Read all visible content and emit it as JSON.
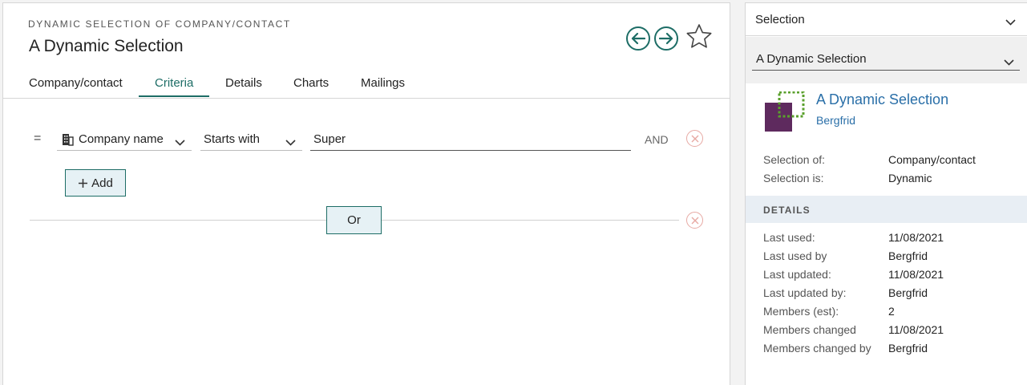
{
  "header": {
    "subtitle": "DYNAMIC SELECTION OF COMPANY/CONTACT",
    "title": "A Dynamic Selection"
  },
  "tabs": [
    {
      "label": "Company/contact",
      "active": false
    },
    {
      "label": "Criteria",
      "active": true
    },
    {
      "label": "Details",
      "active": false
    },
    {
      "label": "Charts",
      "active": false
    },
    {
      "label": "Mailings",
      "active": false
    }
  ],
  "criteria": {
    "eq_symbol": "=",
    "field": "Company name",
    "operator": "Starts with",
    "value": "Super",
    "conjunction": "AND",
    "add_label": "Add",
    "or_label": "Or"
  },
  "sidebar": {
    "header_label": "Selection",
    "selected": "A Dynamic Selection",
    "card": {
      "name": "A Dynamic Selection",
      "owner": "Bergfrid"
    },
    "summary": [
      {
        "label": "Selection of:",
        "value": "Company/contact"
      },
      {
        "label": "Selection is:",
        "value": "Dynamic"
      }
    ],
    "details_heading": "DETAILS",
    "details": [
      {
        "label": "Last used:",
        "value": "11/08/2021"
      },
      {
        "label": "Last used by",
        "value": "Bergfrid"
      },
      {
        "label": "Last updated:",
        "value": "11/08/2021"
      },
      {
        "label": "Last updated by:",
        "value": "Bergfrid"
      },
      {
        "label": "Members (est):",
        "value": "2"
      },
      {
        "label": "Members changed",
        "value": "11/08/2021"
      },
      {
        "label": "Members changed by",
        "value": "Bergfrid"
      }
    ]
  },
  "colors": {
    "accent": "#1d6d66",
    "link": "#2a6fa8",
    "remove": "#e7a9a3",
    "logo_purple": "#5e2a5e",
    "logo_green": "#5aa02c"
  }
}
